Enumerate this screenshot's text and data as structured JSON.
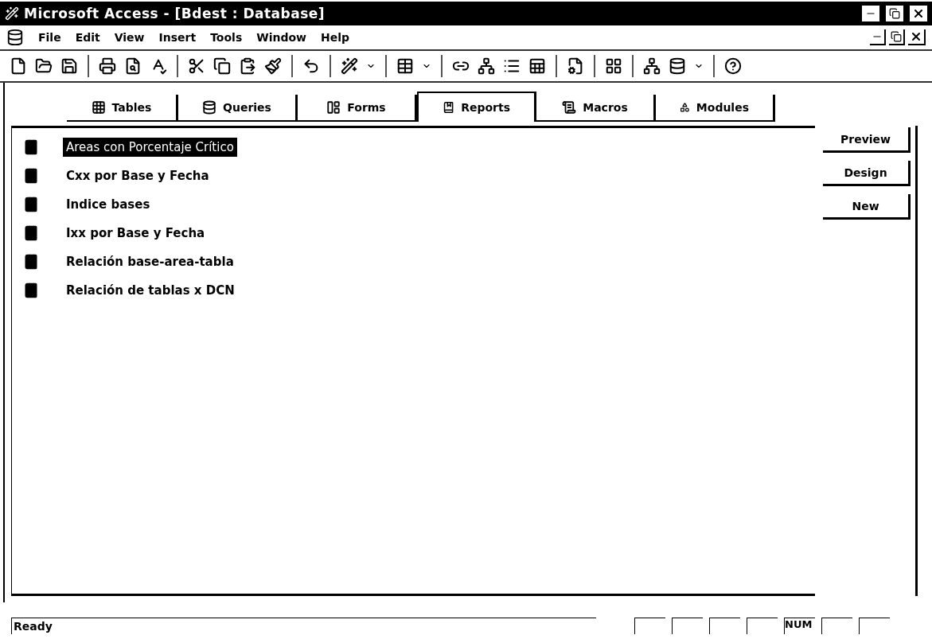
{
  "window": {
    "title": "Microsoft Access - [Bdest : Database]"
  },
  "menu": [
    "File",
    "Edit",
    "View",
    "Insert",
    "Tools",
    "Window",
    "Help"
  ],
  "tabs": [
    {
      "label": "Tables",
      "kind": "tables",
      "selected": false
    },
    {
      "label": "Queries",
      "kind": "queries",
      "selected": false
    },
    {
      "label": "Forms",
      "kind": "forms",
      "selected": false
    },
    {
      "label": "Reports",
      "kind": "reports",
      "selected": true
    },
    {
      "label": "Macros",
      "kind": "macros",
      "selected": false
    },
    {
      "label": "Modules",
      "kind": "modules",
      "selected": false
    }
  ],
  "items": [
    {
      "name": "Areas con Porcentaje Crítico",
      "selected": true
    },
    {
      "name": "Cxx por Base y Fecha",
      "selected": false
    },
    {
      "name": "Indice bases",
      "selected": false
    },
    {
      "name": "Ixx por Base y Fecha",
      "selected": false
    },
    {
      "name": "Relación base-area-tabla",
      "selected": false
    },
    {
      "name": "Relación de tablas x DCN",
      "selected": false
    }
  ],
  "buttons": [
    "Preview",
    "Design",
    "New"
  ],
  "status_bar": {
    "text": "Ready",
    "indicators": [
      {
        "kind": "blank"
      },
      {
        "kind": "blank"
      },
      {
        "kind": "blank"
      },
      {
        "kind": "blank"
      },
      {
        "kind": "text",
        "label": "NUM"
      },
      {
        "kind": "blank"
      },
      {
        "kind": "blank"
      }
    ]
  }
}
